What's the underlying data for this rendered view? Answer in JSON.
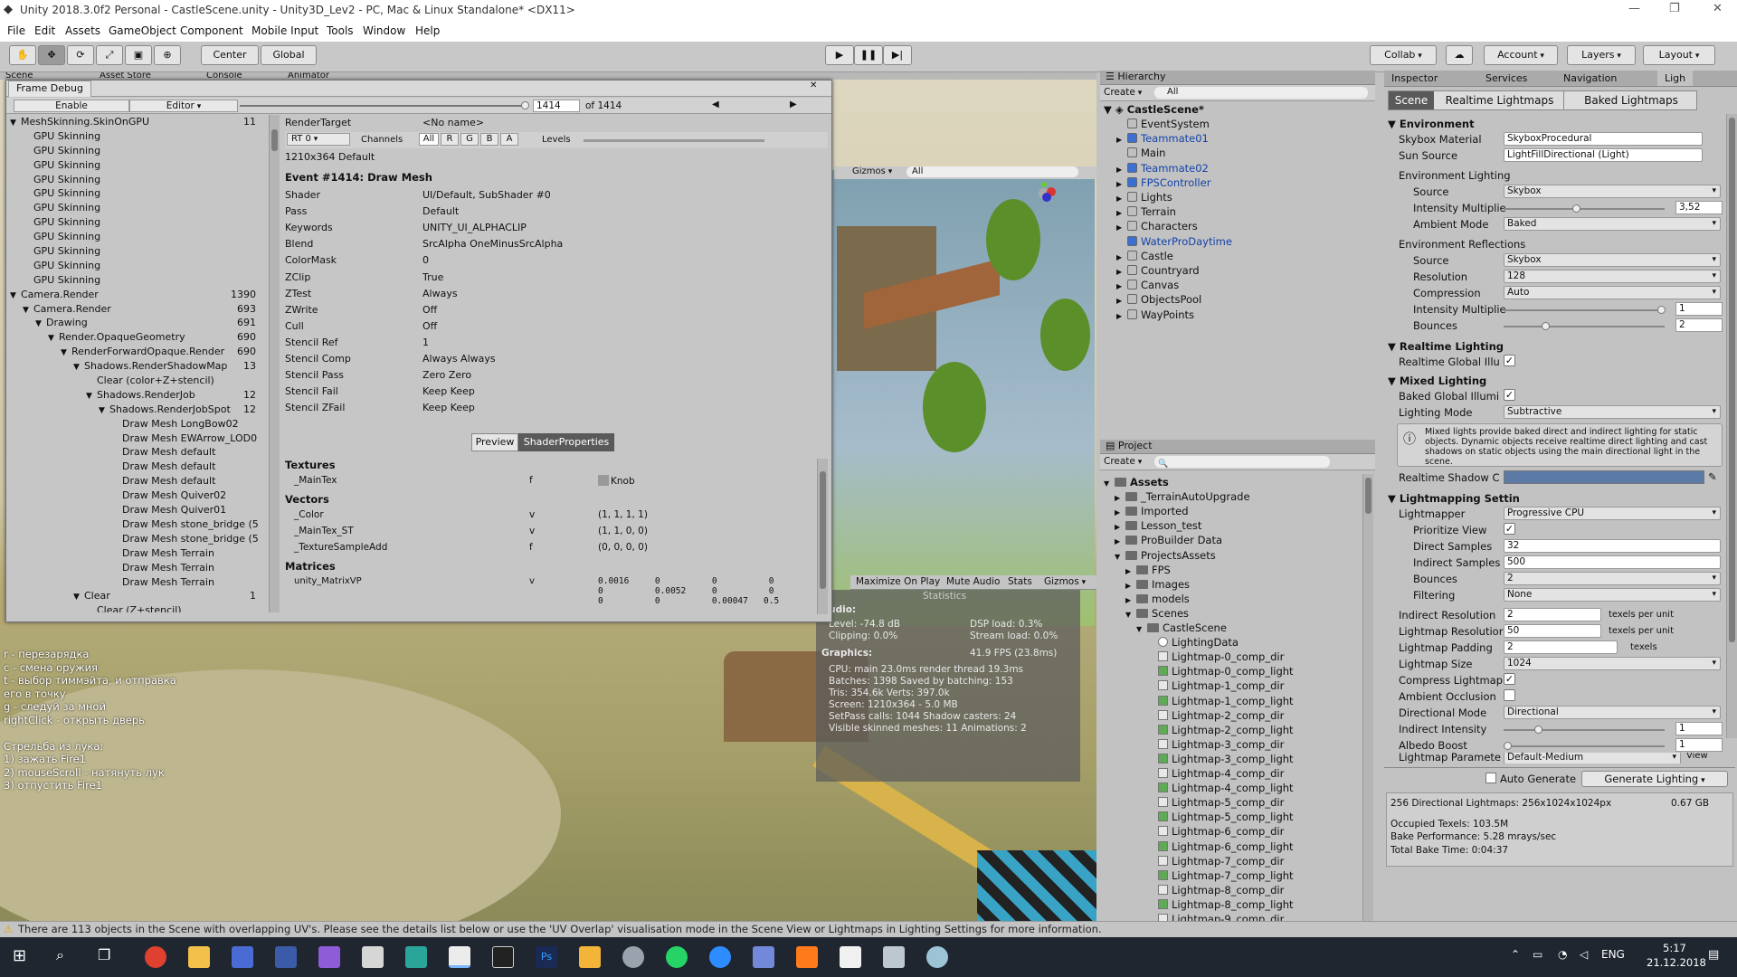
{
  "window": {
    "title": "Unity 2018.3.0f2 Personal - CastleScene.unity - Unity3D_Lev2 - PC, Mac & Linux Standalone* <DX11>",
    "minimize": "—",
    "restore": "❐",
    "close": "✕"
  },
  "menu": [
    "File",
    "Edit",
    "Assets",
    "GameObject",
    "Component",
    "Mobile Input",
    "Tools",
    "Window",
    "Help"
  ],
  "toolbar": {
    "center": "Center",
    "global": "Global",
    "collab": "Collab",
    "account": "Account",
    "layers": "Layers",
    "layout": "Layout"
  },
  "scene_tabs": [
    "Scene",
    "Asset Store",
    "Console",
    "Animator"
  ],
  "frame_debug": {
    "title": "Frame Debug",
    "enable": "Enable",
    "editor": "Editor",
    "frame": "1414",
    "of": "of 1414",
    "tree": [
      {
        "t": "MeshSkinning.SkinOnGPU",
        "c": "11",
        "i": 0,
        "a": "▼"
      },
      {
        "t": "GPU Skinning",
        "c": "",
        "i": 1,
        "a": ""
      },
      {
        "t": "GPU Skinning",
        "c": "",
        "i": 1,
        "a": ""
      },
      {
        "t": "GPU Skinning",
        "c": "",
        "i": 1,
        "a": ""
      },
      {
        "t": "GPU Skinning",
        "c": "",
        "i": 1,
        "a": ""
      },
      {
        "t": "GPU Skinning",
        "c": "",
        "i": 1,
        "a": ""
      },
      {
        "t": "GPU Skinning",
        "c": "",
        "i": 1,
        "a": ""
      },
      {
        "t": "GPU Skinning",
        "c": "",
        "i": 1,
        "a": ""
      },
      {
        "t": "GPU Skinning",
        "c": "",
        "i": 1,
        "a": ""
      },
      {
        "t": "GPU Skinning",
        "c": "",
        "i": 1,
        "a": ""
      },
      {
        "t": "GPU Skinning",
        "c": "",
        "i": 1,
        "a": ""
      },
      {
        "t": "GPU Skinning",
        "c": "",
        "i": 1,
        "a": ""
      },
      {
        "t": "Camera.Render",
        "c": "1390",
        "i": 0,
        "a": "▼"
      },
      {
        "t": "Camera.Render",
        "c": "693",
        "i": 1,
        "a": "▼"
      },
      {
        "t": "Drawing",
        "c": "691",
        "i": 2,
        "a": "▼"
      },
      {
        "t": "Render.OpaqueGeometry",
        "c": "690",
        "i": 3,
        "a": "▼"
      },
      {
        "t": "RenderForwardOpaque.Render",
        "c": "690",
        "i": 4,
        "a": "▼"
      },
      {
        "t": "Shadows.RenderShadowMap",
        "c": "13",
        "i": 5,
        "a": "▼"
      },
      {
        "t": "Clear (color+Z+stencil)",
        "c": "",
        "i": 6,
        "a": ""
      },
      {
        "t": "Shadows.RenderJob",
        "c": "12",
        "i": 6,
        "a": "▼"
      },
      {
        "t": "Shadows.RenderJobSpot",
        "c": "12",
        "i": 7,
        "a": "▼"
      },
      {
        "t": "Draw Mesh LongBow02",
        "c": "",
        "i": 8,
        "a": ""
      },
      {
        "t": "Draw Mesh EWArrow_LOD0",
        "c": "",
        "i": 8,
        "a": ""
      },
      {
        "t": "Draw Mesh default",
        "c": "",
        "i": 8,
        "a": ""
      },
      {
        "t": "Draw Mesh default",
        "c": "",
        "i": 8,
        "a": ""
      },
      {
        "t": "Draw Mesh default",
        "c": "",
        "i": 8,
        "a": ""
      },
      {
        "t": "Draw Mesh Quiver02",
        "c": "",
        "i": 8,
        "a": ""
      },
      {
        "t": "Draw Mesh Quiver01",
        "c": "",
        "i": 8,
        "a": ""
      },
      {
        "t": "Draw Mesh stone_bridge (5",
        "c": "",
        "i": 8,
        "a": ""
      },
      {
        "t": "Draw Mesh stone_bridge (5",
        "c": "",
        "i": 8,
        "a": ""
      },
      {
        "t": "Draw Mesh Terrain",
        "c": "",
        "i": 8,
        "a": ""
      },
      {
        "t": "Draw Mesh Terrain",
        "c": "",
        "i": 8,
        "a": ""
      },
      {
        "t": "Draw Mesh Terrain",
        "c": "",
        "i": 8,
        "a": ""
      },
      {
        "t": "Clear",
        "c": "1",
        "i": 5,
        "a": "▼"
      },
      {
        "t": "Clear (Z+stencil)",
        "c": "",
        "i": 6,
        "a": ""
      }
    ],
    "render_target_label": "RenderTarget",
    "render_target": "<No name>",
    "rt": "RT 0",
    "channels": "Channels",
    "ch": [
      "All",
      "R",
      "G",
      "B",
      "A"
    ],
    "levels": "Levels",
    "size": "1210x364 Default",
    "event": "Event #1414: Draw Mesh",
    "props": [
      [
        "Shader",
        "UI/Default, SubShader #0"
      ],
      [
        "Pass",
        "Default"
      ],
      [
        "Keywords",
        "UNITY_UI_ALPHACLIP"
      ],
      [
        "Blend",
        "SrcAlpha OneMinusSrcAlpha"
      ],
      [
        "ColorMask",
        "0"
      ],
      [
        "ZClip",
        "True"
      ],
      [
        "ZTest",
        "Always"
      ],
      [
        "ZWrite",
        "Off"
      ],
      [
        "Cull",
        "Off"
      ],
      [
        "Stencil Ref",
        "1"
      ],
      [
        "Stencil Comp",
        "Always Always"
      ],
      [
        "Stencil Pass",
        "Zero Zero"
      ],
      [
        "Stencil Fail",
        "Keep Keep"
      ],
      [
        "Stencil ZFail",
        "Keep Keep"
      ]
    ],
    "preview": "Preview",
    "shader_props": "ShaderProperties",
    "textures": "Textures",
    "tex": [
      [
        "_MainTex",
        "f",
        "Knob"
      ]
    ],
    "vectors": "Vectors",
    "vec": [
      [
        "_Color",
        "v",
        "(1, 1, 1, 1)"
      ],
      [
        "_MainTex_ST",
        "v",
        "(1, 1, 0, 0)"
      ],
      [
        "_TextureSampleAdd",
        "f",
        "(0, 0, 0, 0)"
      ]
    ],
    "matrices": "Matrices",
    "mat_name": "unity_MatrixVP",
    "mat_type": "v",
    "mat_r1": "0.0016     0          0          0",
    "mat_r2": "0          0.0052     0          0",
    "mat_r3": "0          0          0.00047   0.5"
  },
  "game": {
    "gizmos": "Gizmos",
    "search": "All",
    "maximize": "Maximize On Play",
    "mute": "Mute Audio",
    "stats": "Stats",
    "gizmos2": "Gizmos"
  },
  "stats": {
    "title": "Statistics",
    "audio": "Audio:",
    "level": "Level: -74.8 dB",
    "clipping": "Clipping: 0.0%",
    "dsp": "DSP load: 0.3%",
    "stream": "Stream load: 0.0%",
    "graphics": "Graphics:",
    "fps": "41.9 FPS (23.8ms)",
    "cpu": "CPU: main 23.0ms  render thread 19.3ms",
    "batches": "Batches: 1398    Saved by batching: 153",
    "tris": "Tris: 354.6k    Verts: 397.0k",
    "screen": "Screen: 1210x364 - 5.0 MB",
    "setpass": "SetPass calls: 1044  Shadow casters: 24",
    "skinned": "Visible skinned meshes: 11  Animations: 2"
  },
  "overlay": [
    "r - перезарядка",
    "c - смена оружия",
    "t - выбор тиммэйта, и отправка",
    "его в точку",
    "g - следуй за мной",
    "rightClick - открыть дверь",
    "",
    "Стрельба из лука:",
    "1) зажать Fire1",
    "2) mouseScroll - натянуть лук",
    "3) отпустить Fire1"
  ],
  "hierarchy": {
    "title": "Hierarchy",
    "create": "Create",
    "search": "All",
    "scene": "CastleScene*",
    "items": [
      {
        "t": "EventSystem",
        "p": false,
        "a": ""
      },
      {
        "t": "Teammate01",
        "p": true,
        "a": "▶"
      },
      {
        "t": "Main",
        "p": false,
        "a": ""
      },
      {
        "t": "Teammate02",
        "p": true,
        "a": "▶"
      },
      {
        "t": "FPSController",
        "p": true,
        "a": "▶"
      },
      {
        "t": "Lights",
        "p": false,
        "a": "▶"
      },
      {
        "t": "Terrain",
        "p": false,
        "a": "▶"
      },
      {
        "t": "Characters",
        "p": false,
        "a": "▶"
      },
      {
        "t": "WaterProDaytime",
        "p": true,
        "a": ""
      },
      {
        "t": "Castle",
        "p": false,
        "a": "▶"
      },
      {
        "t": "Countryard",
        "p": false,
        "a": "▶"
      },
      {
        "t": "Canvas",
        "p": false,
        "a": "▶"
      },
      {
        "t": "ObjectsPool",
        "p": false,
        "a": "▶"
      },
      {
        "t": "WayPoints",
        "p": false,
        "a": "▶"
      }
    ]
  },
  "project": {
    "title": "Project",
    "create": "Create",
    "items": [
      {
        "t": "Assets",
        "i": 0,
        "a": "▼",
        "k": "f"
      },
      {
        "t": "_TerrainAutoUpgrade",
        "i": 1,
        "a": "▶",
        "k": "f"
      },
      {
        "t": "Imported",
        "i": 1,
        "a": "▶",
        "k": "f"
      },
      {
        "t": "Lesson_test",
        "i": 1,
        "a": "▶",
        "k": "f"
      },
      {
        "t": "ProBuilder Data",
        "i": 1,
        "a": "▶",
        "k": "f"
      },
      {
        "t": "ProjectsAssets",
        "i": 1,
        "a": "▼",
        "k": "f"
      },
      {
        "t": "FPS",
        "i": 2,
        "a": "▶",
        "k": "f"
      },
      {
        "t": "Images",
        "i": 2,
        "a": "▶",
        "k": "f"
      },
      {
        "t": "models",
        "i": 2,
        "a": "▶",
        "k": "f"
      },
      {
        "t": "Scenes",
        "i": 2,
        "a": "▼",
        "k": "f"
      },
      {
        "t": "CastleScene",
        "i": 3,
        "a": "▼",
        "k": "f"
      },
      {
        "t": "LightingData",
        "i": 4,
        "a": "",
        "k": "d"
      },
      {
        "t": "Lightmap-0_comp_dir",
        "i": 4,
        "a": "",
        "k": "w"
      },
      {
        "t": "Lightmap-0_comp_light",
        "i": 4,
        "a": "",
        "k": "g"
      },
      {
        "t": "Lightmap-1_comp_dir",
        "i": 4,
        "a": "",
        "k": "w"
      },
      {
        "t": "Lightmap-1_comp_light",
        "i": 4,
        "a": "",
        "k": "g"
      },
      {
        "t": "Lightmap-2_comp_dir",
        "i": 4,
        "a": "",
        "k": "w"
      },
      {
        "t": "Lightmap-2_comp_light",
        "i": 4,
        "a": "",
        "k": "g"
      },
      {
        "t": "Lightmap-3_comp_dir",
        "i": 4,
        "a": "",
        "k": "w"
      },
      {
        "t": "Lightmap-3_comp_light",
        "i": 4,
        "a": "",
        "k": "g"
      },
      {
        "t": "Lightmap-4_comp_dir",
        "i": 4,
        "a": "",
        "k": "w"
      },
      {
        "t": "Lightmap-4_comp_light",
        "i": 4,
        "a": "",
        "k": "g"
      },
      {
        "t": "Lightmap-5_comp_dir",
        "i": 4,
        "a": "",
        "k": "w"
      },
      {
        "t": "Lightmap-5_comp_light",
        "i": 4,
        "a": "",
        "k": "g"
      },
      {
        "t": "Lightmap-6_comp_dir",
        "i": 4,
        "a": "",
        "k": "w"
      },
      {
        "t": "Lightmap-6_comp_light",
        "i": 4,
        "a": "",
        "k": "g"
      },
      {
        "t": "Lightmap-7_comp_dir",
        "i": 4,
        "a": "",
        "k": "w"
      },
      {
        "t": "Lightmap-7_comp_light",
        "i": 4,
        "a": "",
        "k": "g"
      },
      {
        "t": "Lightmap-8_comp_dir",
        "i": 4,
        "a": "",
        "k": "w"
      },
      {
        "t": "Lightmap-8_comp_light",
        "i": 4,
        "a": "",
        "k": "g"
      },
      {
        "t": "Lightmap-9_comp_dir",
        "i": 4,
        "a": "",
        "k": "w"
      }
    ]
  },
  "inspector": {
    "tabs": [
      "Inspector",
      "Services",
      "Navigation",
      "Ligh"
    ],
    "sub": [
      "Scene",
      "Realtime Lightmaps",
      "Baked Lightmaps"
    ],
    "environment": "Environment",
    "skybox_mat_l": "Skybox Material",
    "skybox_mat": "SkyboxProcedural",
    "sun_l": "Sun Source",
    "sun": "LightFillDirectional (Light)",
    "env_lighting": "Environment Lighting",
    "source_l": "Source",
    "source": "Skybox",
    "intensity_l": "Intensity Multiplie",
    "intensity": "3,52",
    "ambient_l": "Ambient Mode",
    "ambient": "Baked",
    "env_refl": "Environment Reflections",
    "rsource": "Skybox",
    "res_l": "Resolution",
    "res": "128",
    "comp_l": "Compression",
    "comp": "Auto",
    "rint": "1",
    "bounces_l": "Bounces",
    "rbounces": "2",
    "realtime": "Realtime Lighting",
    "rgi_l": "Realtime Global Illu",
    "mixed": "Mixed Lighting",
    "bgi_l": "Baked Global Illumi",
    "mode_l": "Lighting Mode",
    "mode": "Subtractive",
    "info": "Mixed lights provide baked direct and indirect lighting for static objects. Dynamic objects receive realtime direct lighting and cast shadows on static objects using the main directional light in the scene.",
    "shadow_l": "Realtime Shadow C",
    "lm_settings": "Lightmapping Settin",
    "lightmapper_l": "Lightmapper",
    "lightmapper": "Progressive CPU",
    "prio_l": "Prioritize View",
    "ds_l": "Direct Samples",
    "ds": "32",
    "is_l": "Indirect Samples",
    "is": "500",
    "lb": "2",
    "filt_l": "Filtering",
    "filt": "None",
    "ires_l": "Indirect Resolution",
    "ires": "2",
    "tpu": "texels per unit",
    "lres_l": "Lightmap Resolutior",
    "lres": "50",
    "pad_l": "Lightmap Padding",
    "pad": "2",
    "texels": "texels",
    "size_l": "Lightmap Size",
    "size": "1024",
    "compress_l": "Compress Lightmap",
    "ao_l": "Ambient Occlusion",
    "dir_l": "Directional Mode",
    "dir": "Directional",
    "iint_l": "Indirect Intensity",
    "iint": "1",
    "albedo_l": "Albedo Boost",
    "albedo": "1",
    "params_l": "Lightmap Paramete",
    "params": "Default-Medium",
    "view": "View",
    "auto": "Auto Generate",
    "generate": "Generate Lighting",
    "s1": "256 Directional Lightmaps: 256x1024x1024px",
    "s1b": "0.67 GB",
    "s2": "Occupied Texels: 103.5M",
    "s3": "Bake Performance: 5.28 mrays/sec",
    "s4": "Total Bake Time: 0:04:37"
  },
  "status": "There are 113 objects in the Scene with overlapping UV's. Please see the details list below or use the 'UV Overlap' visualisation mode in the Scene View or Lightmaps in Lighting Settings for more information.",
  "taskbar": {
    "lang": "ENG",
    "time": "5:17",
    "date": "21.12.2018"
  }
}
